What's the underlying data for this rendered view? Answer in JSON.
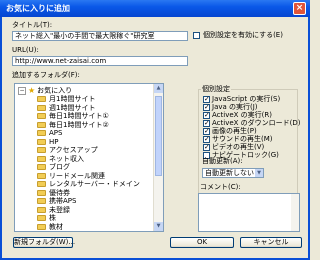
{
  "window": {
    "title": "お気に入りに追加",
    "close_glyph": "×"
  },
  "title_label": "タイトル(T):",
  "title_value": "ネット総入\"最小の手間で最大限稼ぐ\"研究室",
  "offline_checkbox": {
    "label": "個別設定を有効にする(E)",
    "checked": false
  },
  "url_label": "URL(U):",
  "url_value": "http://www.net-zaisai.com",
  "folder_label": "追加するフォルダ(F):",
  "tree": {
    "root": "お気に入り",
    "items": [
      "月1時間サイト",
      "週1時間サイト",
      "毎日1時間サイト①",
      "毎日1時間サイト②",
      "APS",
      "HP",
      "アクセスアップ",
      "ネット収入",
      "ブログ",
      "リードメール関連",
      "レンタルサーバー・ドメイン",
      "優待券",
      "携帯APS",
      "未登録",
      "株",
      "教材"
    ]
  },
  "settings": {
    "group_label": "個別設定",
    "options": [
      {
        "label": "JavaScript の実行(S)",
        "checked": true
      },
      {
        "label": "Java の実行(J)",
        "checked": true
      },
      {
        "label": "ActiveX の実行(R)",
        "checked": true
      },
      {
        "label": "ActiveX のダウンロード(D)",
        "checked": true
      },
      {
        "label": "画像の再生(P)",
        "checked": true
      },
      {
        "label": "サウンドの再生(M)",
        "checked": true
      },
      {
        "label": "ビデオの再生(V)",
        "checked": true
      },
      {
        "label": "ナビゲートロック(G)",
        "checked": false
      }
    ],
    "auto_refresh_label": "自動更新(A):",
    "auto_refresh_value": "自動更新しない"
  },
  "comment_label": "コメント(C):",
  "buttons": {
    "new_folder": "新規フォルダ(W)...",
    "ok": "OK",
    "cancel": "キャンセル"
  }
}
